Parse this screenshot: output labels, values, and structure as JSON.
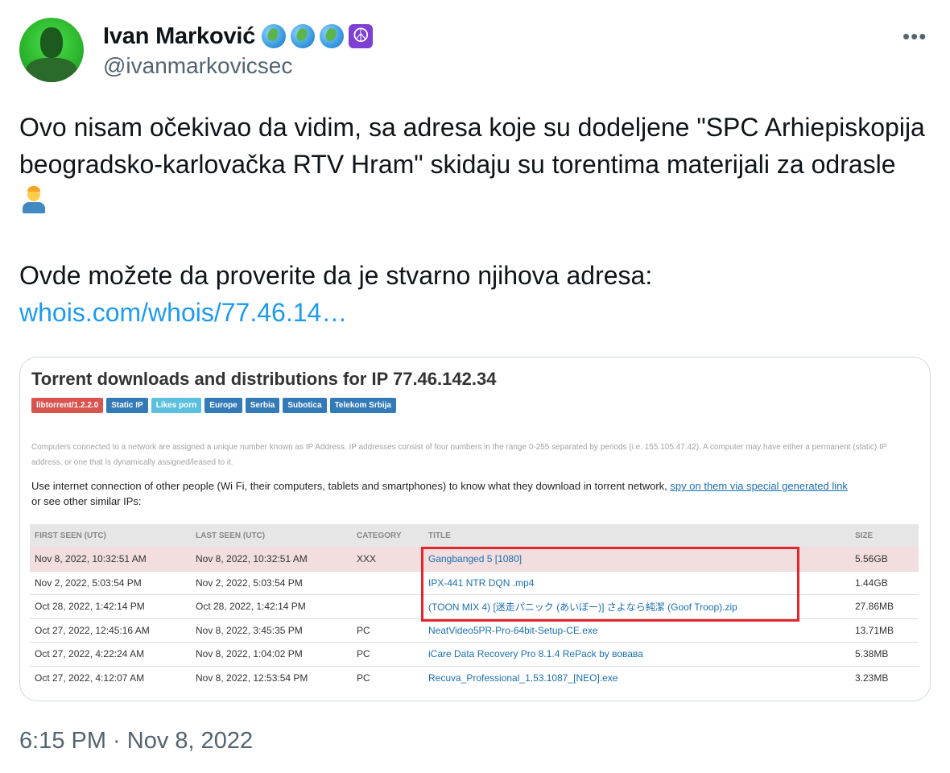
{
  "author": {
    "name": "Ivan Marković",
    "handle": "@ivanmarkovicsec",
    "emojis": [
      "globe-americas-icon",
      "globe-africa-icon",
      "globe-asia-icon",
      "peace-symbol-icon"
    ]
  },
  "more_label": "•••",
  "tweet": {
    "line1": "Ovo nisam očekivao da vidim, sa adresa koje su dodeljene \"SPC Arhiepiskopija beogradsko-karlovačka RTV Hram\" skidaju su torentima materijali za odrasle",
    "line2": "Ovde možete da proverite da je stvarno njihova adresa:",
    "link": "whois.com/whois/77.46.14…"
  },
  "card": {
    "title": "Torrent downloads and distributions for IP 77.46.142.34",
    "badges": [
      {
        "label": "libtorrent/1.2.2.0",
        "color": "#d9534f"
      },
      {
        "label": "Static IP",
        "color": "#337ab7"
      },
      {
        "label": "Likes porn",
        "color": "#5bc0de"
      },
      {
        "label": "Europe",
        "color": "#337ab7"
      },
      {
        "label": "Serbia",
        "color": "#337ab7"
      },
      {
        "label": "Subotica",
        "color": "#337ab7"
      },
      {
        "label": "Telekom Srbija",
        "color": "#337ab7"
      }
    ],
    "note": "Computers connected to a network are assigned a unique number known as IP Address. IP addresses consist of four numbers in the range 0-255 separated by periods (i.e. 155.105.47.42). A computer may have either a permanent (static) IP address, or one that is dynamically assigned/leased to it.",
    "use_text": "Use internet connection of other people (Wi Fi, their computers, tablets and smartphones) to know what they download in torrent network,",
    "spy_link": "spy on them via special generated link",
    "use_tail": "or see other similar IPs:",
    "columns": [
      "FIRST SEEN (UTC)",
      "LAST SEEN (UTC)",
      "CATEGORY",
      "TITLE",
      "SIZE"
    ],
    "rows": [
      {
        "first": "Nov 8, 2022, 10:32:51 AM",
        "last": "Nov 8, 2022, 10:32:51 AM",
        "category": "XXX",
        "title": "Gangbanged 5 [1080]",
        "size": "5.56GB"
      },
      {
        "first": "Nov 2, 2022, 5:03:54 PM",
        "last": "Nov 2, 2022, 5:03:54 PM",
        "category": "",
        "title": "IPX-441 NTR DQN .mp4",
        "size": "1.44GB"
      },
      {
        "first": "Oct 28, 2022, 1:42:14 PM",
        "last": "Oct 28, 2022, 1:42:14 PM",
        "category": "",
        "title": "(TOON MIX 4) [迷走パニック (あいぼー)] さよなら純潔 (Goof Troop).zip",
        "size": "27.86MB"
      },
      {
        "first": "Oct 27, 2022, 12:45:16 AM",
        "last": "Nov 8, 2022, 3:45:35 PM",
        "category": "PC",
        "title": "NeatVideo5PR-Pro-64bit-Setup-CE.exe",
        "size": "13.71MB"
      },
      {
        "first": "Oct 27, 2022, 4:22:24 AM",
        "last": "Nov 8, 2022, 1:04:02 PM",
        "category": "PC",
        "title": "iCare Data Recovery Pro 8.1.4 RePack by вовава",
        "size": "5.38MB"
      },
      {
        "first": "Oct 27, 2022, 4:12:07 AM",
        "last": "Nov 8, 2022, 12:53:54 PM",
        "category": "PC",
        "title": "Recuva_Professional_1.53.1087_[NEO].exe",
        "size": "3.23MB"
      }
    ]
  },
  "timestamp": "6:15 PM · Nov 8, 2022",
  "colors": {
    "link": "#1d9bf0",
    "highlight_box": "#e3262c",
    "muted": "#536471"
  }
}
